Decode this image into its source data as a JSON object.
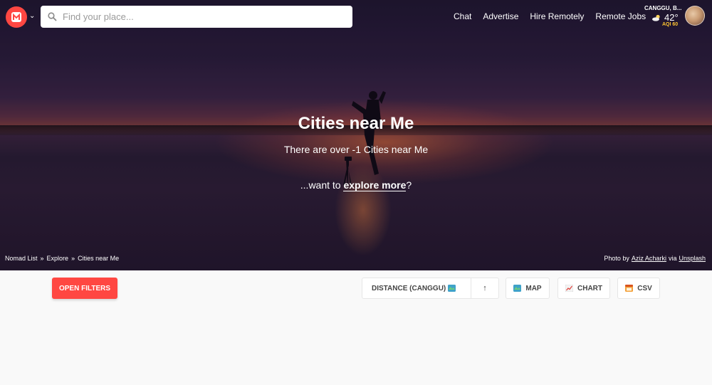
{
  "search": {
    "placeholder": "Find your place..."
  },
  "nav": {
    "items": [
      {
        "label": "Chat"
      },
      {
        "label": "Advertise"
      },
      {
        "label": "Hire Remotely"
      },
      {
        "label": "Remote Jobs"
      }
    ]
  },
  "weather": {
    "city": "CANGGU, B...",
    "temp": "42°",
    "aqi": "AQI 60",
    "icon": "partly-cloudy-icon"
  },
  "hero": {
    "title": "Cities near Me",
    "subtitle": "There are over -1 Cities near Me",
    "explore_prefix": "...want to ",
    "explore_link": "explore more",
    "explore_suffix": "?"
  },
  "breadcrumb": {
    "items": [
      "Nomad List",
      "Explore",
      "Cities near Me"
    ],
    "separator": "»"
  },
  "credit": {
    "prefix": "Photo by",
    "author": "Aziz Acharki",
    "via": "via",
    "source": "Unsplash"
  },
  "toolbar": {
    "open_filters": "OPEN FILTERS",
    "sort_label": "DISTANCE (CANGGU)",
    "sort_direction": "↑",
    "map": "MAP",
    "chart": "CHART",
    "csv": "CSV"
  },
  "colors": {
    "brand": "#ff4742",
    "aqi": "#ffc531"
  }
}
